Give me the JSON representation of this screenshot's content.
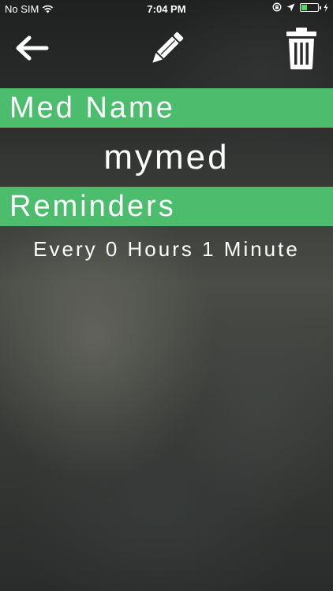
{
  "status_bar": {
    "carrier": "No SIM",
    "time": "7:04 PM",
    "battery_level": 0.35,
    "battery_color": "#4cd964"
  },
  "toolbar": {
    "back_icon": "arrow-left-icon",
    "edit_icon": "pencil-icon",
    "delete_icon": "trash-icon"
  },
  "accent_color": "#4cbd6d",
  "sections": {
    "med_name": {
      "header": "Med Name",
      "value": "mymed"
    },
    "reminders": {
      "header": "Reminders",
      "value": "Every 0 Hours 1 Minute"
    }
  }
}
